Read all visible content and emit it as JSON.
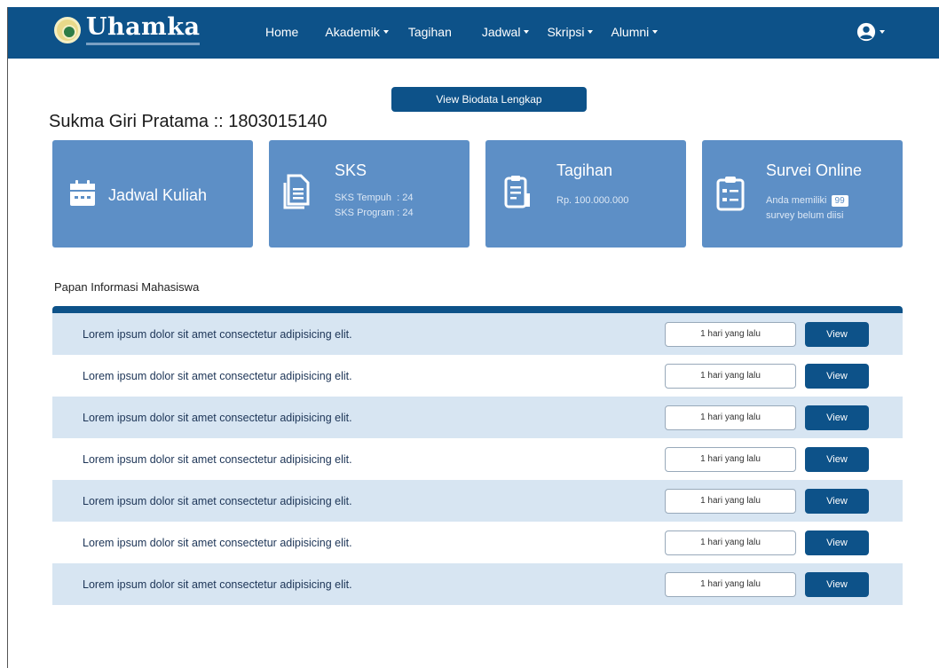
{
  "navbar": {
    "brand_name": "Uhamka",
    "menu": [
      {
        "label": "Home",
        "dropdown": false
      },
      {
        "label": "Akademik",
        "dropdown": true
      },
      {
        "label": "Tagihan",
        "dropdown": false
      },
      {
        "label": "Jadwal",
        "dropdown": true
      },
      {
        "label": "Skripsi",
        "dropdown": true
      },
      {
        "label": "Alumni",
        "dropdown": true
      }
    ],
    "user_icon": "user-circle-icon"
  },
  "profile": {
    "name_line": "Sukma Giri Pratama :: 1803015140",
    "biodata_button": "View Biodata Lengkap"
  },
  "cards": {
    "jadwal": {
      "title": "Jadwal Kuliah",
      "icon": "calendar-icon"
    },
    "sks": {
      "title": "SKS",
      "tempuh": "SKS Tempuh  : 24",
      "program": "SKS Program : 24",
      "icon": "document-icon"
    },
    "tagihan": {
      "title": "Tagihan",
      "amount": "Rp. 100.000.000",
      "icon": "receipt-icon"
    },
    "survei": {
      "title": "Survei Online",
      "line1": "Anda memiliki",
      "count": "99",
      "line2": "survey belum diisi",
      "icon": "clipboard-icon"
    }
  },
  "board": {
    "title": "Papan Informasi Mahasiswa",
    "rows": [
      {
        "text": "Lorem ipsum dolor sit amet consectetur adipisicing elit.",
        "time": "1 hari yang lalu",
        "action": "View"
      },
      {
        "text": "Lorem ipsum dolor sit amet consectetur adipisicing elit.",
        "time": "1 hari yang lalu",
        "action": "View"
      },
      {
        "text": "Lorem ipsum dolor sit amet consectetur adipisicing elit.",
        "time": "1 hari yang lalu",
        "action": "View"
      },
      {
        "text": "Lorem ipsum dolor sit amet consectetur adipisicing elit.",
        "time": "1 hari yang lalu",
        "action": "View"
      },
      {
        "text": "Lorem ipsum dolor sit amet consectetur adipisicing elit.",
        "time": "1 hari yang lalu",
        "action": "View"
      },
      {
        "text": "Lorem ipsum dolor sit amet consectetur adipisicing elit.",
        "time": "1 hari yang lalu",
        "action": "View"
      },
      {
        "text": "Lorem ipsum dolor sit amet consectetur adipisicing elit.",
        "time": "1 hari yang lalu",
        "action": "View"
      }
    ]
  },
  "colors": {
    "primary": "#0d5289",
    "card": "#5d8fc6",
    "row_alt": "#d7e5f2"
  }
}
